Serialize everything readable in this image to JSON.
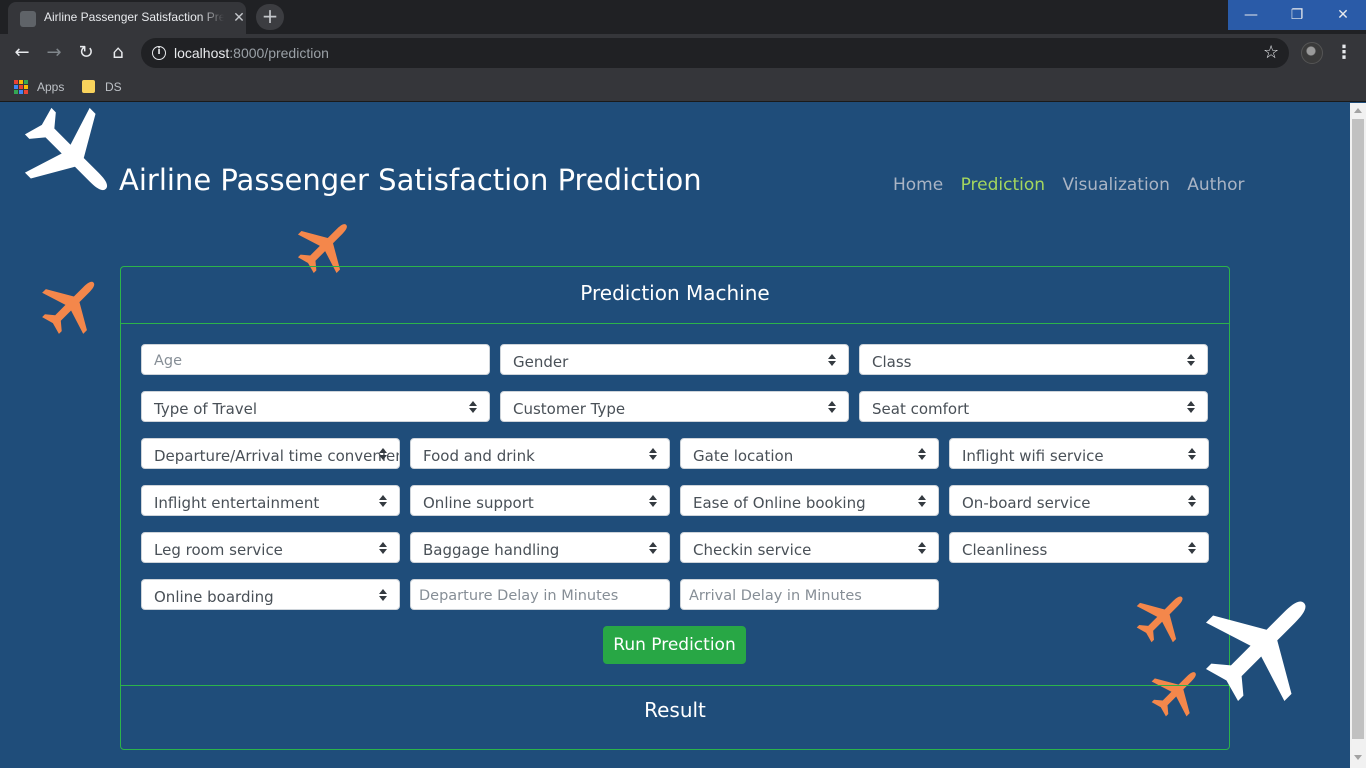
{
  "browser": {
    "tab_title": "Airline Passenger Satisfaction Prediction",
    "url_host": "localhost",
    "url_rest": ":8000/prediction",
    "bookmarks": [
      "Apps",
      "DS"
    ]
  },
  "site": {
    "title": "Airline Passenger Satisfaction Prediction",
    "nav": [
      "Home",
      "Prediction",
      "Visualization",
      "Author"
    ],
    "active_nav": "Prediction"
  },
  "form": {
    "header": "Prediction Machine",
    "row1": {
      "age_placeholder": "Age",
      "gender": "Gender",
      "class": "Class"
    },
    "row2": {
      "type_of_travel": "Type of Travel",
      "customer_type": "Customer Type",
      "seat_comfort": "Seat comfort"
    },
    "row3": [
      "Departure/Arrival time convenient",
      "Food and drink",
      "Gate location",
      "Inflight wifi service"
    ],
    "row4": [
      "Inflight entertainment",
      "Online support",
      "Ease of Online booking",
      "On-board service"
    ],
    "row5": [
      "Leg room service",
      "Baggage handling",
      "Checkin service",
      "Cleanliness"
    ],
    "row6": {
      "online_boarding": "Online boarding",
      "departure_delay_placeholder": "Departure Delay in Minutes",
      "arrival_delay_placeholder": "Arrival Delay in Minutes"
    },
    "submit": "Run Prediction",
    "result_header": "Result"
  },
  "colors": {
    "page_bg": "#1f4d7a",
    "accent_green": "#28a745",
    "nav_active": "#a4d65e",
    "plane_orange": "#f4874b",
    "plane_white": "#ffffff"
  }
}
